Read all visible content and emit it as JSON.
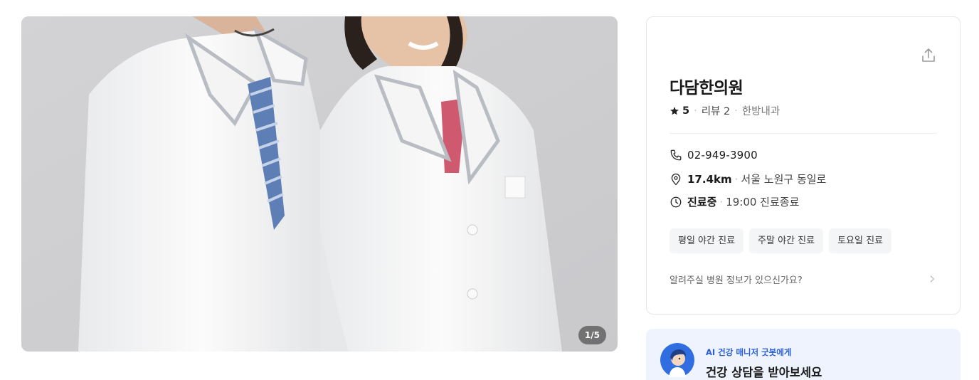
{
  "gallery": {
    "counter": "1/5"
  },
  "clinic": {
    "name": "다담한의원",
    "rating": "5",
    "reviews": "리뷰 2",
    "category": "한방내과",
    "phone": "02-949-3900",
    "distance": "17.4km",
    "address": "서울 노원구 동일로",
    "status": "진료중",
    "hours": "19:00 진료종료",
    "tags": [
      "평일 야간 진료",
      "주말 야간 진료",
      "토요일 진료"
    ],
    "report_prompt": "알려주실 병원 정보가 있으신가요?"
  },
  "ai_banner": {
    "subtitle": "AI 건강 매니저 굿봇에게",
    "title": "건강 상담을 받아보세요"
  },
  "colors": {
    "accent": "#2a5fd8",
    "tag_bg": "#f4f5f7",
    "banner_bg": "#eef3fd"
  }
}
